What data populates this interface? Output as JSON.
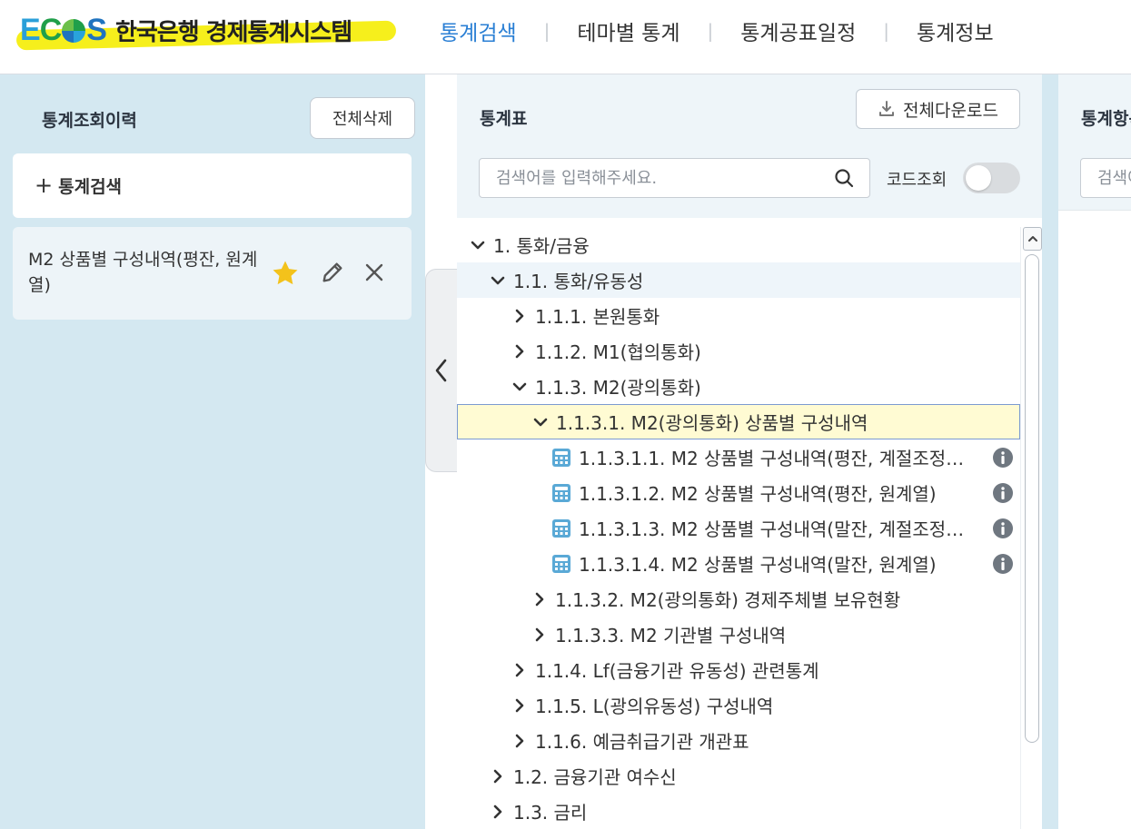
{
  "header": {
    "logo_text": "ECOS",
    "site_title": "한국은행 경제통계시스템",
    "nav": [
      {
        "label": "통계검색",
        "active": true
      },
      {
        "label": "테마별 통계",
        "active": false
      },
      {
        "label": "통계공표일정",
        "active": false
      },
      {
        "label": "통계정보",
        "active": false
      }
    ]
  },
  "left_panel": {
    "title": "통계조회이력",
    "clear_button": "전체삭제",
    "add_search": "통계검색",
    "history": [
      {
        "title": "M2 상품별 구성내역(평잔, 원계열)",
        "favorite": true
      }
    ]
  },
  "stats_panel": {
    "title": "통계표",
    "download_button": "전체다운로드",
    "search_placeholder": "검색어를 입력해주세요.",
    "code_lookup_label": "코드조회",
    "code_lookup_on": false,
    "tree": [
      {
        "label": "1. 통화/금융",
        "expanded": true
      },
      {
        "label": "1.1. 통화/유동성",
        "expanded": true
      },
      {
        "label": "1.1.1. 본원통화",
        "expanded": false
      },
      {
        "label": "1.1.2. M1(협의통화)",
        "expanded": false
      },
      {
        "label": "1.1.3. M2(광의통화)",
        "expanded": true
      },
      {
        "label": "1.1.3.1. M2(광의통화) 상품별 구성내역",
        "expanded": true,
        "selected": true
      },
      {
        "label": "1.1.3.1.1. M2 상품별 구성내역(평잔, 계절조정…",
        "table": true
      },
      {
        "label": "1.1.3.1.2. M2 상품별 구성내역(평잔, 원계열)",
        "table": true
      },
      {
        "label": "1.1.3.1.3. M2 상품별 구성내역(말잔, 계절조정…",
        "table": true
      },
      {
        "label": "1.1.3.1.4. M2 상품별 구성내역(말잔, 원계열)",
        "table": true
      },
      {
        "label": "1.1.3.2. M2(광의통화) 경제주체별 보유현황",
        "expanded": false
      },
      {
        "label": "1.1.3.3. M2 기관별 구성내역",
        "expanded": false
      },
      {
        "label": "1.1.4. Lf(금융기관 유동성) 관련통계",
        "expanded": false
      },
      {
        "label": "1.1.5. L(광의유동성) 구성내역",
        "expanded": false
      },
      {
        "label": "1.1.6. 예금취급기관 개관표",
        "expanded": false
      },
      {
        "label": "1.2. 금융기관 여수신",
        "expanded": false
      },
      {
        "label": "1.3. 금리",
        "expanded": false
      }
    ]
  },
  "items_panel": {
    "title": "통계항목",
    "search_placeholder": "검색어를 입력해주세요."
  },
  "colors": {
    "accent": "#2a7fd4",
    "panel_bg": "#d4e8f1",
    "highlight": "#f2ea14",
    "selected_row": "#fffbd3",
    "star": "#f3c21b"
  }
}
